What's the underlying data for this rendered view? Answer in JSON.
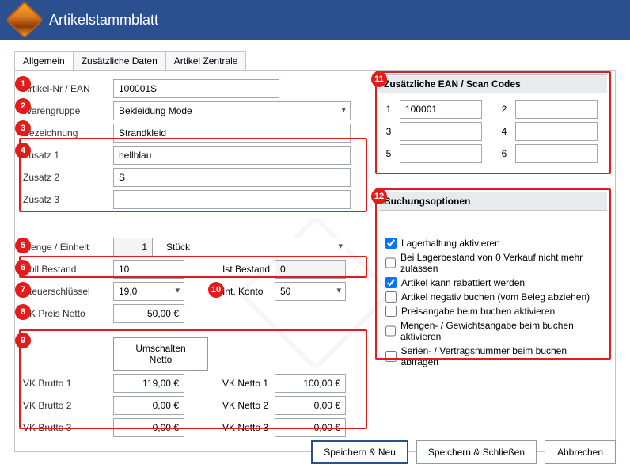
{
  "header": {
    "title": "Artikelstammblatt"
  },
  "tabs": [
    "Allgemein",
    "Zusätzliche Daten",
    "Artikel Zentrale"
  ],
  "labels": {
    "artikelnr": "Artikel-Nr / EAN",
    "warengruppe": "Warengruppe",
    "bezeichnung": "Bezeichnung",
    "zusatz1": "Zusatz 1",
    "zusatz2": "Zusatz 2",
    "zusatz3": "Zusatz 3",
    "mengeEinheit": "Menge / Einheit",
    "sollBestand": "Soll Bestand",
    "istBestand": "Ist Bestand",
    "steuer": "Steuerschlüssel",
    "intKonto": "Int. Konto",
    "ekNetto": "EK Preis Netto",
    "umschalten": "Umschalten Netto",
    "vkb1": "VK Brutto 1",
    "vkb2": "VK Brutto 2",
    "vkb3": "VK Brutto 3",
    "vkn1": "VK Netto 1",
    "vkn2": "VK Netto 2",
    "vkn3": "VK Netto 3",
    "eanHeader": "Zusätzliche EAN / Scan Codes",
    "e1": "1",
    "e2": "2",
    "e3": "3",
    "e4": "4",
    "e5": "5",
    "e6": "6",
    "bookHeader": "Buchungsoptionen"
  },
  "values": {
    "artikelnr": "100001S",
    "warengruppe": "Bekleidung Mode",
    "bezeichnung": "Strandkleid",
    "zusatz1": "hellblau",
    "zusatz2": "S",
    "zusatz3": "",
    "menge": "1",
    "einheit": "Stück",
    "sollBestand": "10",
    "istBestand": "0",
    "steuer": "19,0",
    "intKonto": "50",
    "ekNetto": "50,00 €",
    "vkb1": "119,00 €",
    "vkb2": "0,00 €",
    "vkb3": "0,00 €",
    "vkn1": "100,00 €",
    "vkn2": "0,00 €",
    "vkn3": "0,00 €",
    "ean1": "100001",
    "ean2": "",
    "ean3": "",
    "ean4": "",
    "ean5": "",
    "ean6": ""
  },
  "checks": [
    {
      "label": "Lagerhaltung aktivieren",
      "checked": true
    },
    {
      "label": "Bei Lagerbestand von 0 Verkauf nicht mehr zulassen",
      "checked": false
    },
    {
      "label": "Artikel kann rabattiert werden",
      "checked": true
    },
    {
      "label": "Artikel negativ buchen (vom Beleg abziehen)",
      "checked": false
    },
    {
      "label": "Preisangabe beim buchen aktivieren",
      "checked": false
    },
    {
      "label": "Mengen- / Gewichtsangabe beim buchen aktivieren",
      "checked": false
    },
    {
      "label": "Serien- / Vertragsnummer beim buchen abfragen",
      "checked": false
    }
  ],
  "buttons": {
    "saveNew": "Speichern & Neu",
    "saveClose": "Speichern & Schließen",
    "cancel": "Abbrechen"
  },
  "badges": {
    "b1": "1",
    "b2": "2",
    "b3": "3",
    "b4": "4",
    "b5": "5",
    "b6": "6",
    "b7": "7",
    "b8": "8",
    "b9": "9",
    "b10": "10",
    "b11": "11",
    "b12": "12"
  }
}
